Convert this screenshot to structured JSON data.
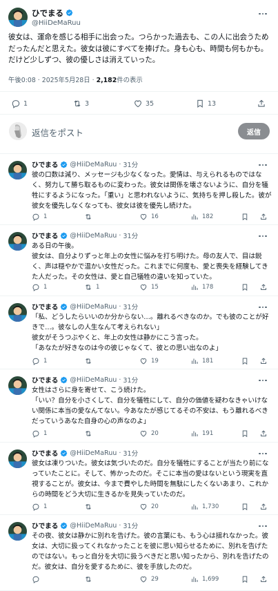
{
  "main_post": {
    "author_name": "ひでまる",
    "author_handle": "@HiiDeMaRuu",
    "text": "彼女は、運命を感じる相手に出会った。つらかった過去も、この人に出会うためだったんだと思えた。彼女は彼にすべてを捧げた。身も心も、時間も何もかも。だけど少しずつ、彼の優しさは消えていった。",
    "timestamp": "午後0:08 · 2025年5月28日 · ",
    "views_count": "2,182",
    "views_label": "件の表示",
    "replies": "1",
    "reposts": "3",
    "likes": "35",
    "bookmarks": "13"
  },
  "composer": {
    "placeholder": "返信をポスト",
    "button_label": "返信"
  },
  "replies": [
    {
      "name": "ひでまる",
      "handle": "@HiiDeMaRuu",
      "time": "31分",
      "text": "彼の口数は減り、メッセージも少なくなった。愛情は、与えられるものではなく、努力して勝ち取るものに変わった。彼女は関係を壊さないように、自分を犠牲にするようになった。「重い」と思われないように、気持ちを押し殺した。彼が彼女を優先しなくなっても、彼女は彼を優先し続けた。",
      "replies": "1",
      "reposts": "",
      "likes": "16",
      "views": "182"
    },
    {
      "name": "ひでまる",
      "handle": "@HiiDeMaRuu",
      "time": "31分",
      "text": "ある日の午後。\n彼女は、自分よりずっと年上の女性に悩みを打ち明けた。母の友人で、目は鋭く、声は穏やかで温かい女性だった。これまでに何度も、愛と喪失を経験してきた人だった。その女性は、愛と自己犠牲の違いを知っていた。",
      "replies": "1",
      "reposts": "1",
      "likes": "15",
      "views": "178"
    },
    {
      "name": "ひでまる",
      "handle": "@HiiDeMaRuu",
      "time": "31分",
      "text": "「私、どうしたらいいのか分からない…。離れるべきなのか。でも彼のことが好きで…。彼なしの人生なんて考えられない」\n彼女がそうつぶやくと、年上の女性は静かにこう言った。\n「あなたが好きなのは今の彼じゃなくて、彼との思い出なのよ」",
      "replies": "1",
      "reposts": "",
      "likes": "19",
      "views": "181"
    },
    {
      "name": "ひでまる",
      "handle": "@HiiDeMaRuu",
      "time": "31分",
      "text": "女性はさらに身を寄せて、こう続けた。\n「いい？自分を小さくして、自分を犠牲にして、自分の価値を疑わなきゃいけない関係に本当の愛なんてない。今あなたが感じてるその不安は、もう離れるべきだっていうあなた自身の心の声なのよ」",
      "replies": "1",
      "reposts": "",
      "likes": "20",
      "views": "191"
    },
    {
      "name": "ひでまる",
      "handle": "@HiiDeMaRuu",
      "time": "31分",
      "text": "彼女は凍りついた。彼女は気づいたのだ。自分を犠牲にすることが当たり前になっていたことに。そして、怖かったのだ。そこに本当の愛はないという現実を直視することが。彼女は、今まで費やした時間を無駄にしたくないあまり、これからの時間をどう大切に生きるかを見失っていたのだ。",
      "replies": "1",
      "reposts": "",
      "likes": "20",
      "views": "1,730"
    },
    {
      "name": "ひでまる",
      "handle": "@HiiDeMaRuu",
      "time": "31分",
      "text": "その夜、彼女は静かに別れを告げた。彼の言葉にも、もう心は揺れなかった。彼女は、大切に扱ってくれなかったことを彼に思い知らせるために、別れを告げたのではない。もっと自分を大切に扱うべきだと思い知ったから、別れを告げたのだ。彼女は、自分を愛するために、彼を手放したのだ。",
      "replies": "",
      "reposts": "",
      "likes": "29",
      "views": "1,699"
    }
  ],
  "colors": {
    "text": "#0f1419",
    "secondary": "#536471",
    "border": "#eff3f4",
    "verified": "#1d9bf0",
    "reply_button": "#8a8d91"
  },
  "icons": [
    "reply-icon",
    "repost-icon",
    "like-icon",
    "bookmark-icon",
    "share-icon",
    "views-icon",
    "verified-badge-icon",
    "more-icon"
  ]
}
